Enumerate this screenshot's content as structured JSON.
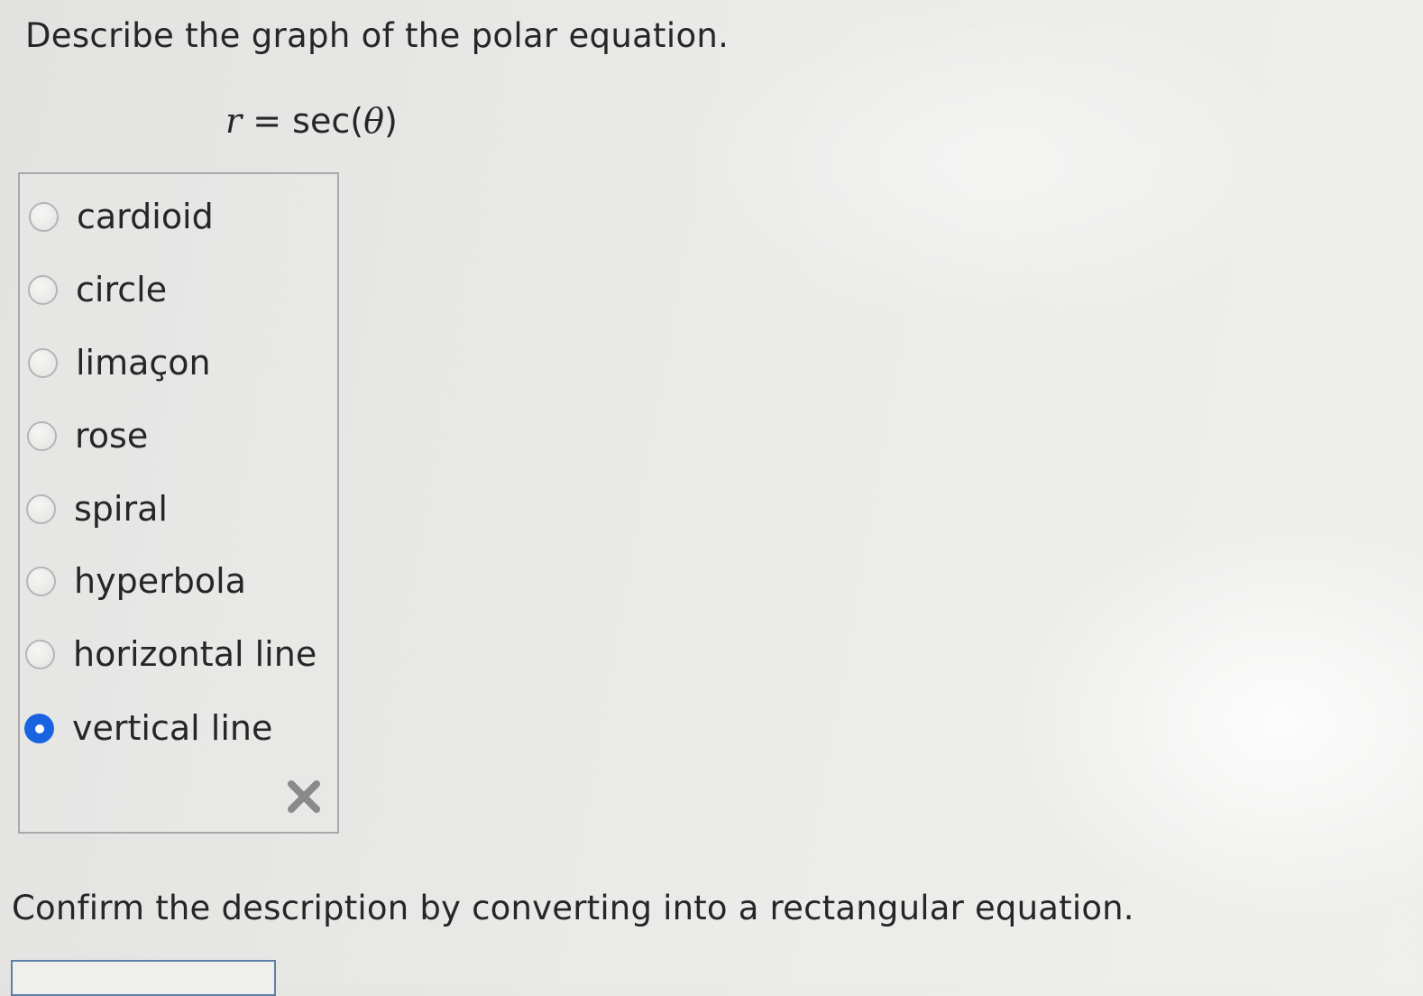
{
  "question": {
    "prompt": "Describe the graph of the polar equation.",
    "equation": {
      "lhs": "r",
      "op": " = ",
      "func": "sec(",
      "arg": "θ",
      "close": ")"
    }
  },
  "choices": [
    {
      "label": "cardioid",
      "selected": false
    },
    {
      "label": "circle",
      "selected": false
    },
    {
      "label": "limaçon",
      "selected": false
    },
    {
      "label": "rose",
      "selected": false
    },
    {
      "label": "spiral",
      "selected": false
    },
    {
      "label": "hyperbola",
      "selected": false
    },
    {
      "label": "horizontal line",
      "selected": false
    },
    {
      "label": "vertical line",
      "selected": true
    }
  ],
  "clear_icon": "x-icon",
  "followup": {
    "prompt": "Confirm the description by converting into a rectangular equation.",
    "answer_value": ""
  },
  "colors": {
    "selected_radio": "#1a63e0",
    "clear_icon": "#8a8a8a",
    "input_border": "#5d7fa6"
  }
}
